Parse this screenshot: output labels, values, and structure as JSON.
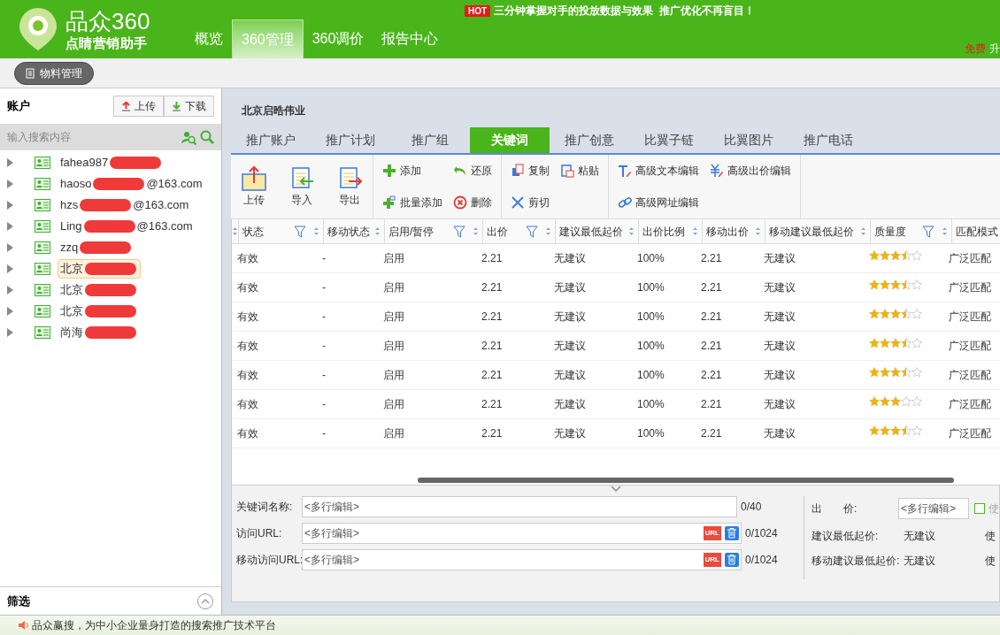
{
  "header": {
    "logo_title": "品众360",
    "logo_subtitle": "点睛营销助手",
    "promo_badge": "HOT",
    "promo_text": "三分钟掌握对手的投放数据与效果  推广优化不再盲目！",
    "free_label": "免费",
    "upgrade_label": "升",
    "nav": [
      {
        "label": "概览",
        "selected": false
      },
      {
        "label": "360管理",
        "selected": true
      },
      {
        "label": "360调价",
        "selected": false
      },
      {
        "label": "报告中心",
        "selected": false
      }
    ]
  },
  "subbar": {
    "button": "物料管理"
  },
  "sidebar": {
    "title": "账户",
    "upload": "上传",
    "download": "下载",
    "search_placeholder": "输入搜索内容",
    "accounts": [
      {
        "prefix": "fahea987",
        "selected": false
      },
      {
        "prefix": "haoso",
        "suffix": "@163.com",
        "selected": false
      },
      {
        "prefix": "hzs",
        "suffix": "@163.com",
        "selected": false
      },
      {
        "prefix": "Ling",
        "suffix": "@163.com",
        "selected": false
      },
      {
        "prefix": "zzq",
        "selected": false
      },
      {
        "prefix": "北京",
        "selected": true
      },
      {
        "prefix": "北京",
        "selected": false
      },
      {
        "prefix": "北京",
        "selected": false
      },
      {
        "prefix": "尚海",
        "selected": false
      }
    ],
    "filter_title": "筛选"
  },
  "main": {
    "company": "北京启晧伟业",
    "tabs": [
      {
        "label": "推广账户",
        "selected": false
      },
      {
        "label": "推广计划",
        "selected": false
      },
      {
        "label": "推广组",
        "selected": false
      },
      {
        "label": "关键词",
        "selected": true
      },
      {
        "label": "推广创意",
        "selected": false
      },
      {
        "label": "比翼子链",
        "selected": false
      },
      {
        "label": "比翼图片",
        "selected": false
      },
      {
        "label": "推广电话",
        "selected": false
      }
    ],
    "toolbar": {
      "big": [
        {
          "kind": "upload",
          "label": "上传"
        },
        {
          "kind": "import",
          "label": "导入"
        },
        {
          "kind": "export",
          "label": "导出"
        }
      ],
      "groups": [
        [
          {
            "kind": "add",
            "label": "添加"
          },
          {
            "kind": "undo",
            "label": "还原"
          },
          {
            "kind": "batch",
            "label": "批量添加"
          },
          {
            "kind": "delete",
            "label": "删除"
          }
        ],
        [
          {
            "kind": "copy",
            "label": "复制"
          },
          {
            "kind": "paste",
            "label": "粘贴"
          },
          {
            "kind": "cut",
            "label": "剪切"
          }
        ],
        [
          {
            "kind": "text",
            "label": "高级文本编辑"
          },
          {
            "kind": "price",
            "label": "高级出价编辑"
          },
          {
            "kind": "link",
            "label": "高级网址编辑"
          }
        ]
      ]
    },
    "table": {
      "columns": [
        {
          "label": "状态",
          "kind": "filterable"
        },
        {
          "label": "移动状态",
          "kind": "plain"
        },
        {
          "label": "启用/暂停",
          "kind": "filterable"
        },
        {
          "label": "出价",
          "kind": "filterable"
        },
        {
          "label": "建议最低起价",
          "kind": "plain"
        },
        {
          "label": "出价比例",
          "kind": "plain"
        },
        {
          "label": "移动出价",
          "kind": "plain"
        },
        {
          "label": "移动建议最低起价",
          "kind": "plain"
        },
        {
          "label": "质量度",
          "kind": "filterable"
        },
        {
          "label": "匹配模式",
          "kind": "plain"
        }
      ],
      "rows": [
        {
          "cells": [
            "有效",
            "-",
            "启用",
            "2.21",
            "无建议",
            "100%",
            "2.21",
            "无建议"
          ],
          "stars": 3.5,
          "match": "广泛匹配"
        },
        {
          "cells": [
            "有效",
            "-",
            "启用",
            "2.21",
            "无建议",
            "100%",
            "2.21",
            "无建议"
          ],
          "stars": 3.5,
          "match": "广泛匹配"
        },
        {
          "cells": [
            "有效",
            "-",
            "启用",
            "2.21",
            "无建议",
            "100%",
            "2.21",
            "无建议"
          ],
          "stars": 3.5,
          "match": "广泛匹配"
        },
        {
          "cells": [
            "有效",
            "-",
            "启用",
            "2.21",
            "无建议",
            "100%",
            "2.21",
            "无建议"
          ],
          "stars": 3.5,
          "match": "广泛匹配"
        },
        {
          "cells": [
            "有效",
            "-",
            "启用",
            "2.21",
            "无建议",
            "100%",
            "2.21",
            "无建议"
          ],
          "stars": 3.5,
          "match": "广泛匹配"
        },
        {
          "cells": [
            "有效",
            "-",
            "启用",
            "2.21",
            "无建议",
            "100%",
            "2.21",
            "无建议"
          ],
          "stars": 3,
          "match": "广泛匹配"
        },
        {
          "cells": [
            "有效",
            "-",
            "启用",
            "2.21",
            "无建议",
            "100%",
            "2.21",
            "无建议"
          ],
          "stars": 3.5,
          "match": "广泛匹配"
        }
      ]
    },
    "form": {
      "fields": [
        {
          "label": "关键词名称:",
          "placeholder": "<多行编辑>",
          "count": "0/40"
        },
        {
          "label": "访问URL:",
          "placeholder": "<多行编辑>",
          "count": "0/1024",
          "url_badge": "URL"
        },
        {
          "label": "移动访问URL:",
          "placeholder": "<多行编辑>",
          "count": "0/1024",
          "url_badge": "URL"
        }
      ],
      "bid_label": "出　　价:",
      "bid_placeholder": "<多行编辑>",
      "use_checkbox": {
        "label": "使",
        "checked": false
      },
      "info": [
        {
          "label": "建议最低起价:",
          "value": "无建议",
          "extra": "使"
        },
        {
          "label": "移动建议最低起价:",
          "value": "无建议",
          "extra": "使"
        }
      ]
    }
  },
  "status_bar": {
    "text": "品众赢搜，为中小企业量身打造的搜索推广技术平台"
  }
}
